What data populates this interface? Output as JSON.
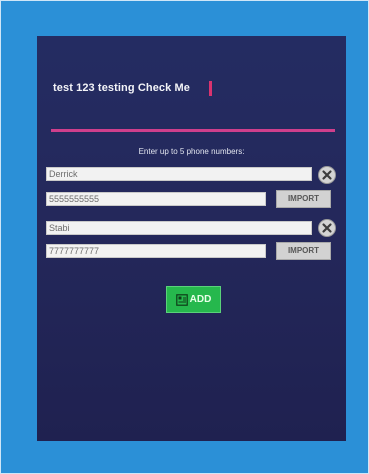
{
  "app": {
    "title": "test 123 testing Check Me",
    "instructions": "Enter up to 5 phone numbers:"
  },
  "contacts": [
    {
      "name": "Derrick",
      "phone": "5555555555",
      "import_label": "IMPORT"
    },
    {
      "name": "Stabi",
      "phone": "7777777777",
      "import_label": "IMPORT"
    }
  ],
  "actions": {
    "add_label": "ADD"
  },
  "colors": {
    "accent": "#cf3f8c",
    "add_button": "#26b84d",
    "background": "#242c62"
  }
}
